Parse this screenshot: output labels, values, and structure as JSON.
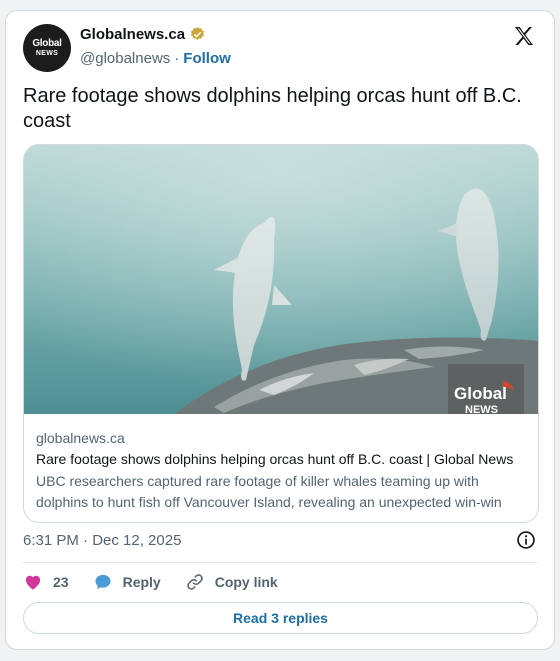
{
  "author": {
    "avatar_text_1": "Global",
    "avatar_text_2": "NEWS",
    "name": "Globalnews.ca",
    "handle": "@globalnews",
    "separator": "·",
    "follow_label": "Follow"
  },
  "tweet": {
    "text": "Rare footage shows dolphins helping orcas hunt off B.C. coast",
    "timestamp": "6:31 PM · Dec 12, 2025"
  },
  "link_card": {
    "watermark_line_1": "Global",
    "watermark_line_2": "NEWS",
    "domain": "globalnews.ca",
    "title": "Rare footage shows dolphins helping orcas hunt off B.C. coast | Global News",
    "description_line_1": "UBC researchers captured rare footage of killer whales teaming up with",
    "description_line_2": "dolphins to hunt fish off Vancouver Island, revealing an unexpected win-win"
  },
  "actions": {
    "like_count": "23",
    "reply_label": "Reply",
    "copy_link_label": "Copy link",
    "read_replies_label": "Read 3 replies"
  },
  "colors": {
    "link_blue": "#1d6fa5",
    "like_pink": "#d4379c",
    "reply_blue": "#4a9bd6",
    "verified_gold": "#c9a43a"
  },
  "icons": [
    "verified-badge-icon",
    "x-logo-icon",
    "info-icon",
    "heart-icon",
    "reply-bubble-icon",
    "link-icon"
  ]
}
